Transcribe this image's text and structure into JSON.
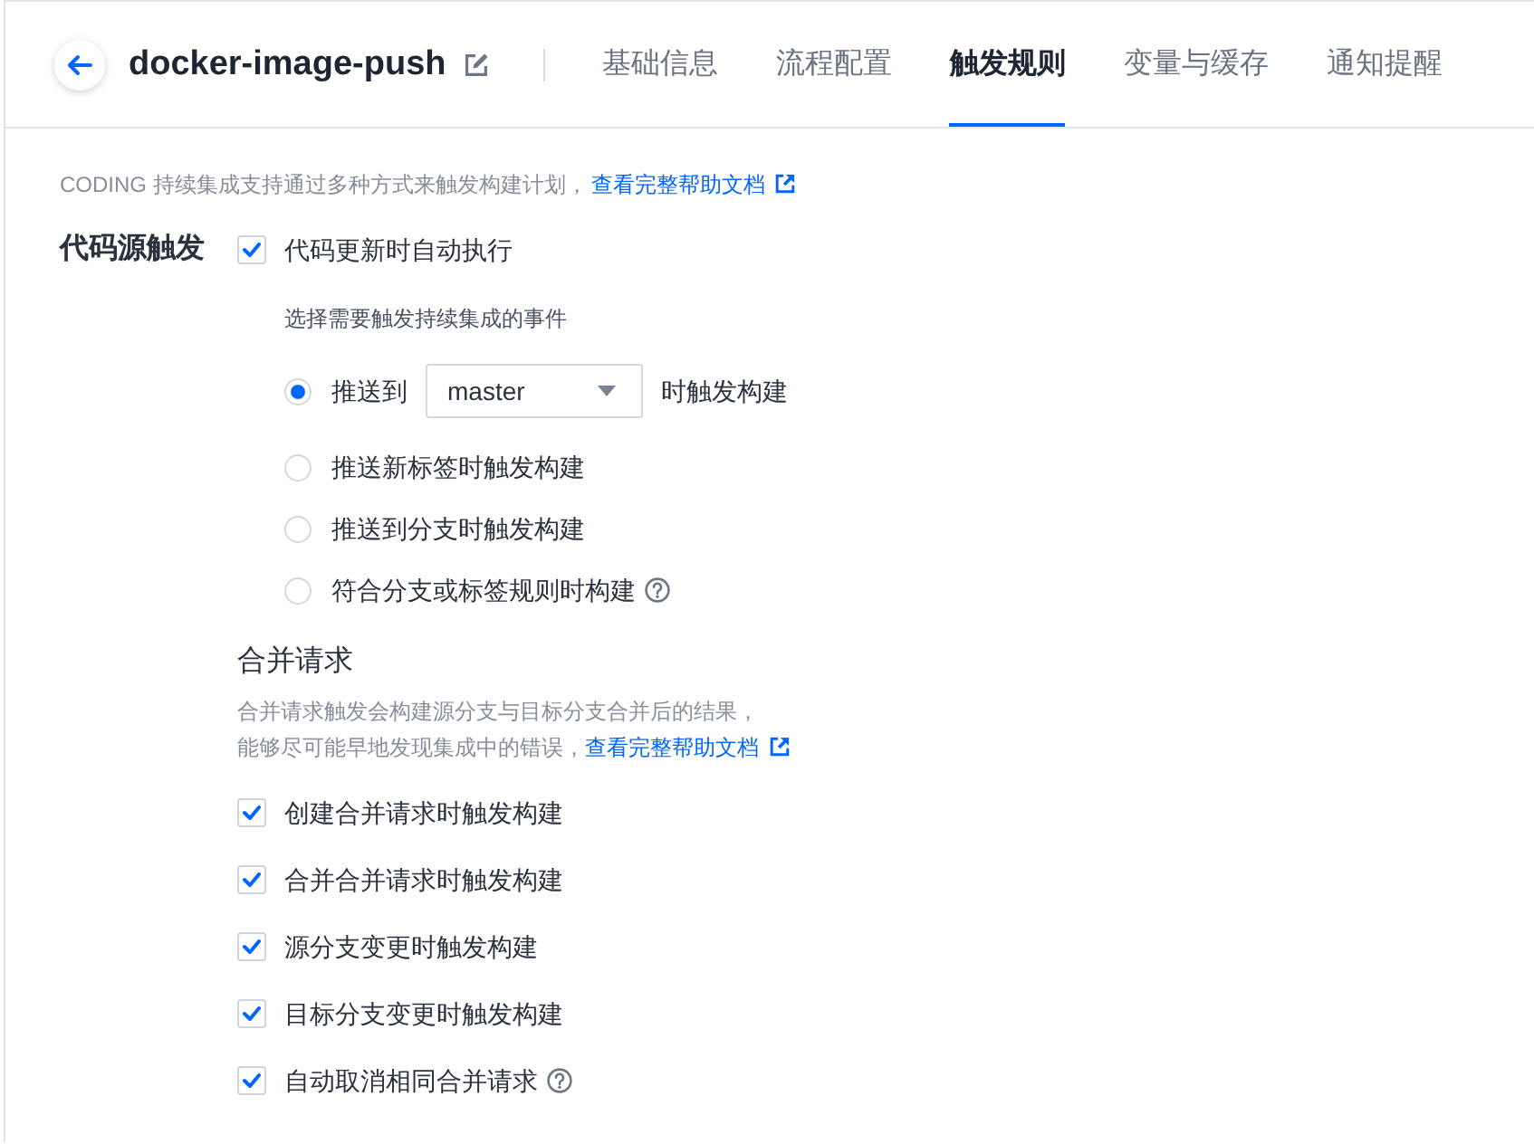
{
  "header": {
    "title": "docker-image-push",
    "tabs": [
      {
        "label": "基础信息",
        "selected": false
      },
      {
        "label": "流程配置",
        "selected": false
      },
      {
        "label": "触发规则",
        "selected": true
      },
      {
        "label": "变量与缓存",
        "selected": false
      },
      {
        "label": "通知提醒",
        "selected": false
      }
    ]
  },
  "intro": {
    "text": "CODING 持续集成支持通过多种方式来触发构建计划，",
    "link": "查看完整帮助文档"
  },
  "code_source": {
    "label": "代码源触发",
    "auto_run": {
      "label": "代码更新时自动执行",
      "checked": true
    },
    "events_hint": "选择需要触发持续集成的事件",
    "events": [
      {
        "kind": "branch",
        "before": "推送到",
        "branch": "master",
        "after": "时触发构建",
        "selected": true,
        "help": false
      },
      {
        "kind": "option",
        "label": "推送新标签时触发构建",
        "selected": false,
        "help": false
      },
      {
        "kind": "option",
        "label": "推送到分支时触发构建",
        "selected": false,
        "help": false
      },
      {
        "kind": "option",
        "label": "符合分支或标签规则时构建",
        "selected": false,
        "help": true
      }
    ]
  },
  "merge_request": {
    "title": "合并请求",
    "description": [
      "合并请求触发会构建源分支与目标分支合并后的结果，",
      "能够尽可能早地发现集成中的错误，"
    ],
    "link": "查看完整帮助文档",
    "options": [
      {
        "label": "创建合并请求时触发构建",
        "checked": true,
        "help": false
      },
      {
        "label": "合并合并请求时触发构建",
        "checked": true,
        "help": false
      },
      {
        "label": "源分支变更时触发构建",
        "checked": true,
        "help": false
      },
      {
        "label": "目标分支变更时触发构建",
        "checked": true,
        "help": false
      },
      {
        "label": "自动取消相同合并请求",
        "checked": true,
        "help": true
      }
    ]
  }
}
